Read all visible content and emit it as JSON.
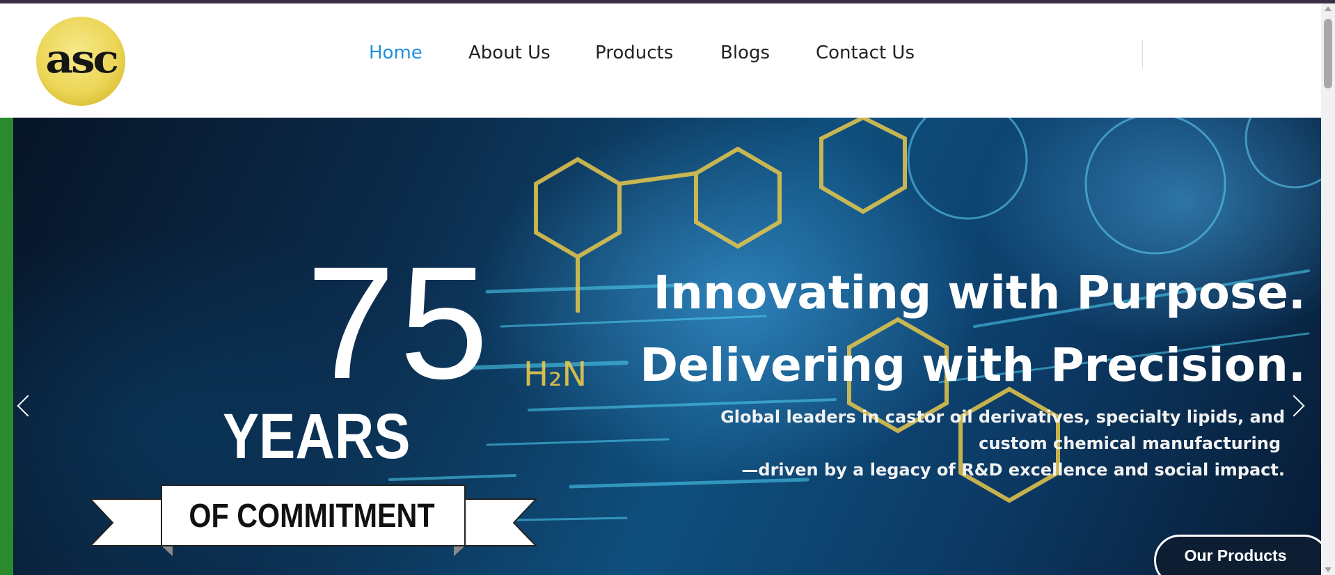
{
  "brand": {
    "logo_text": "asc"
  },
  "nav": {
    "items": [
      {
        "label": "Home",
        "active": true
      },
      {
        "label": "About Us",
        "active": false
      },
      {
        "label": "Products",
        "active": false
      },
      {
        "label": "Blogs",
        "active": false
      },
      {
        "label": "Contact Us",
        "active": false
      }
    ]
  },
  "hero": {
    "badge": {
      "number": "75",
      "unit": "YEARS",
      "ribbon": "OF COMMITMENT"
    },
    "headline_1": "Innovating with Purpose.",
    "headline_2": "Delivering with Precision.",
    "sub_lines": [
      "Global leaders in castor oil derivatives, specialty lipids, and",
      "custom chemical manufacturing",
      "—driven by a legacy of R&D excellence and social impact."
    ],
    "cta_label": "Our Products",
    "prev_icon": "chevron-left",
    "next_icon": "chevron-right"
  },
  "colors": {
    "nav_active": "#1e90e0",
    "nav_default": "#222222",
    "accent_bar": "#2c8a2e",
    "top_strip": "#3a2f45"
  }
}
